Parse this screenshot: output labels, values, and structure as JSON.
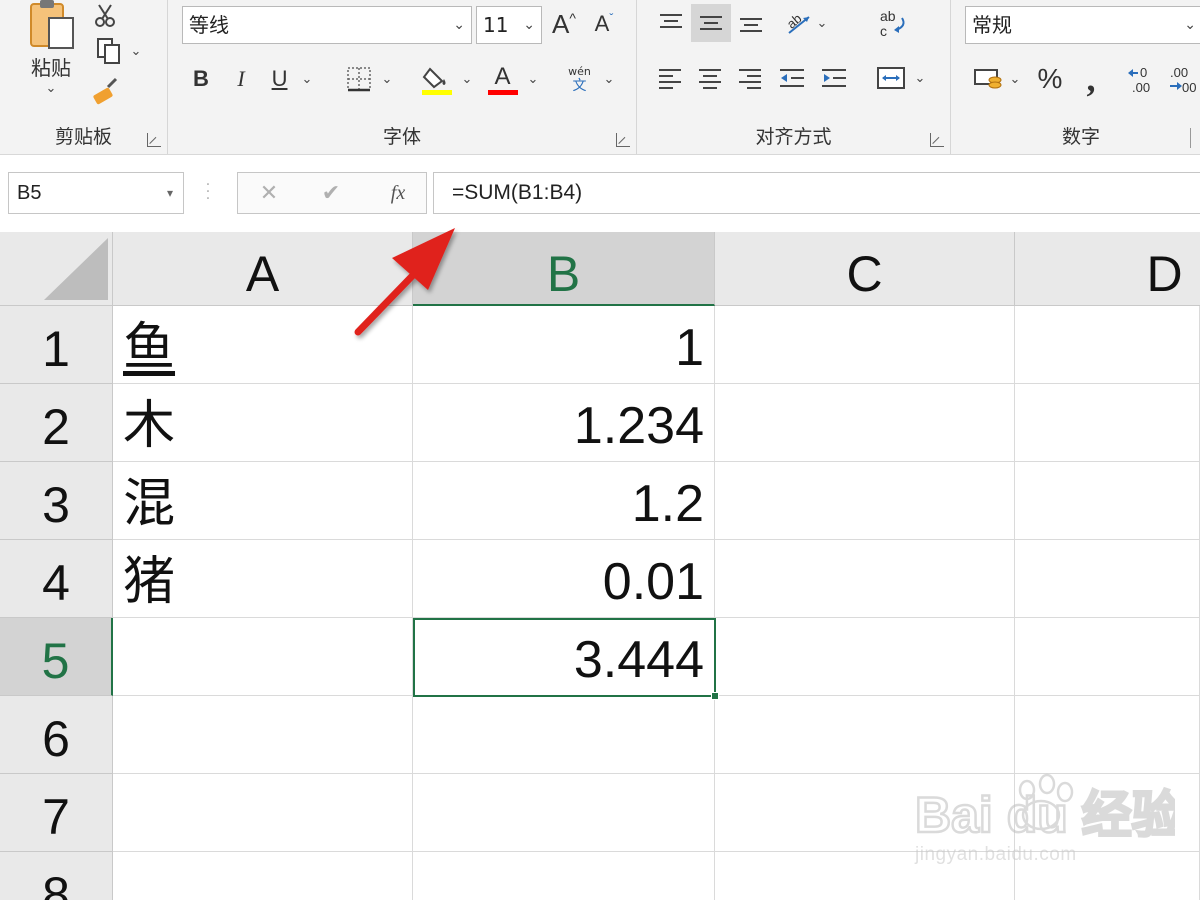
{
  "ribbon": {
    "clipboard": {
      "label": "剪贴板",
      "paste_label": "粘贴"
    },
    "font": {
      "label": "字体",
      "font_name": "等线",
      "font_size": "11",
      "bold": "B",
      "italic": "I",
      "underline": "U",
      "grow_font": "A",
      "shrink_font": "A",
      "font_color_letter": "A",
      "phonetic_top": "wén",
      "phonetic_bottom": "文",
      "highlight_color": "#ffff00",
      "font_color": "#ff0000"
    },
    "alignment": {
      "label": "对齐方式"
    },
    "number": {
      "label": "数字",
      "format": "常规",
      "percent": "%",
      "comma": ",",
      "increase_decimal": "0",
      "decrease_decimal": "00"
    }
  },
  "formula_bar": {
    "name_box": "B5",
    "fx": "fx",
    "formula": "=SUM(B1:B4)"
  },
  "sheet": {
    "columns": [
      "A",
      "B",
      "C",
      "D"
    ],
    "rows": [
      "1",
      "2",
      "3",
      "4",
      "5",
      "6",
      "7",
      "8"
    ],
    "selected_column": "B",
    "selected_row": "5",
    "cells": {
      "A1": "鱼",
      "A2": "木",
      "A3": "混",
      "A4": "猪",
      "B1": "1",
      "B2": "1.234",
      "B3": "1.2",
      "B4": "0.01",
      "B5": "3.444"
    }
  },
  "colors": {
    "accent_green": "#217346",
    "annotation_arrow": "#e0201e"
  },
  "watermark": {
    "brand": "Bai du 经验",
    "url": "jingyan.baidu.com"
  }
}
